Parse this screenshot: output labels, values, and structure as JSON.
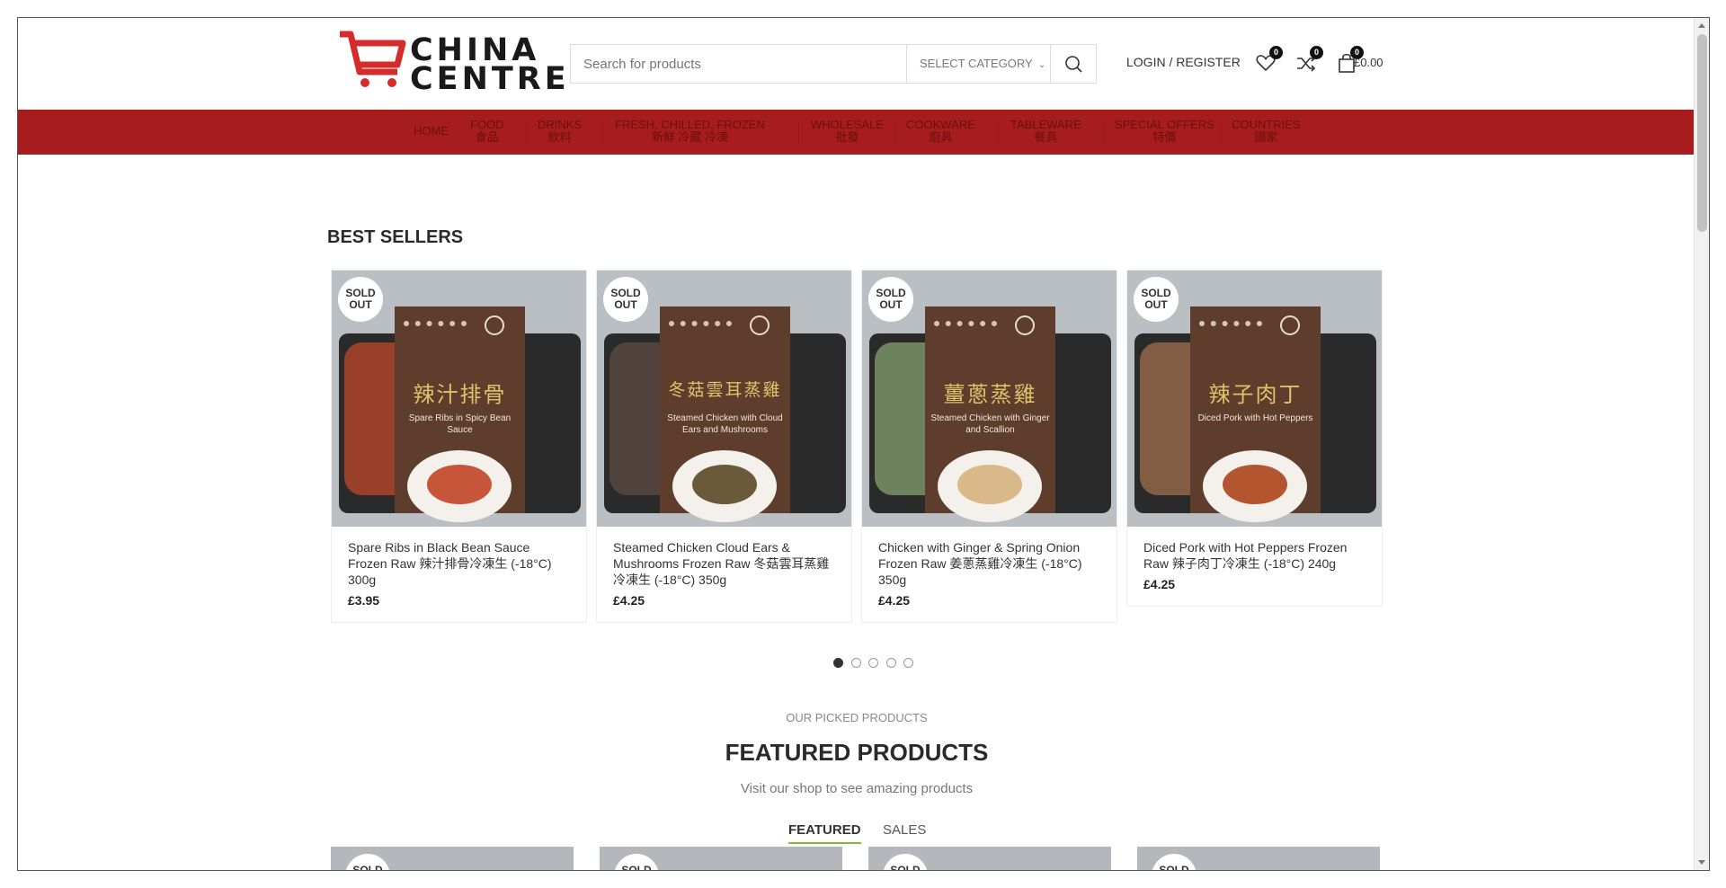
{
  "header": {
    "logo_text_line1": "CHINA",
    "logo_text_line2": "CENTRE",
    "search_placeholder": "Search for products",
    "category_label": "SELECT CATEGORY",
    "login_label": "LOGIN / REGISTER",
    "wishlist_count": "0",
    "compare_count": "0",
    "cart_count": "0",
    "cart_total": "£0.00"
  },
  "nav": {
    "items": [
      {
        "label": "HOME",
        "sub": ""
      },
      {
        "label": "FOOD",
        "sub": "食品"
      },
      {
        "label": "DRINKS",
        "sub": "飲料"
      },
      {
        "label": "FRESH, CHILLED, FROZEN",
        "sub": "新鮮 冷藏 冷凍"
      },
      {
        "label": "WHOLESALE",
        "sub": "批發"
      },
      {
        "label": "COOKWARE",
        "sub": "廚具"
      },
      {
        "label": "TABLEWARE",
        "sub": "餐具"
      },
      {
        "label": "SPECIAL OFFERS",
        "sub": "特價"
      },
      {
        "label": "COUNTRIES",
        "sub": "國家"
      }
    ]
  },
  "best_sellers": {
    "title": "BEST SELLERS",
    "sold_out_line1": "SOLD",
    "sold_out_line2": "OUT",
    "products": [
      {
        "name": "Spare Ribs in Black Bean Sauce Frozen Raw 辣汁排骨冷凍生 (-18°C) 300g",
        "price": "£3.95",
        "label_cn": "辣汁排骨",
        "label_en": "Spare Ribs in Spicy Bean Sauce"
      },
      {
        "name": "Steamed Chicken Cloud Ears & Mushrooms Frozen Raw 冬菇雲耳蒸雞冷凍生 (-18°C) 350g",
        "price": "£4.25",
        "label_cn": "冬菇雲耳蒸雞",
        "label_en": "Steamed Chicken with Cloud Ears and Mushrooms"
      },
      {
        "name": "Chicken with Ginger & Spring Onion Frozen Raw 姜蔥蒸雞冷凍生 (-18°C) 350g",
        "price": "£4.25",
        "label_cn": "薑蔥蒸雞",
        "label_en": "Steamed Chicken with Ginger and Scallion"
      },
      {
        "name": "Diced Pork with Hot Peppers Frozen Raw 辣子肉丁冷凍生 (-18°C) 240g",
        "price": "£4.25",
        "label_cn": "辣子肉丁",
        "label_en": "Diced Pork with Hot Peppers"
      }
    ],
    "pages": 5,
    "active_page": 1
  },
  "featured": {
    "eyebrow": "OUR PICKED PRODUCTS",
    "title": "FEATURED PRODUCTS",
    "subtitle": "Visit our shop to see amazing products",
    "tabs": [
      "FEATURED",
      "SALES"
    ],
    "active_tab": "FEATURED"
  },
  "colors": {
    "nav_bg": "#a71c1c",
    "accent_green": "#83b735",
    "logo_red": "#d62b2b"
  }
}
